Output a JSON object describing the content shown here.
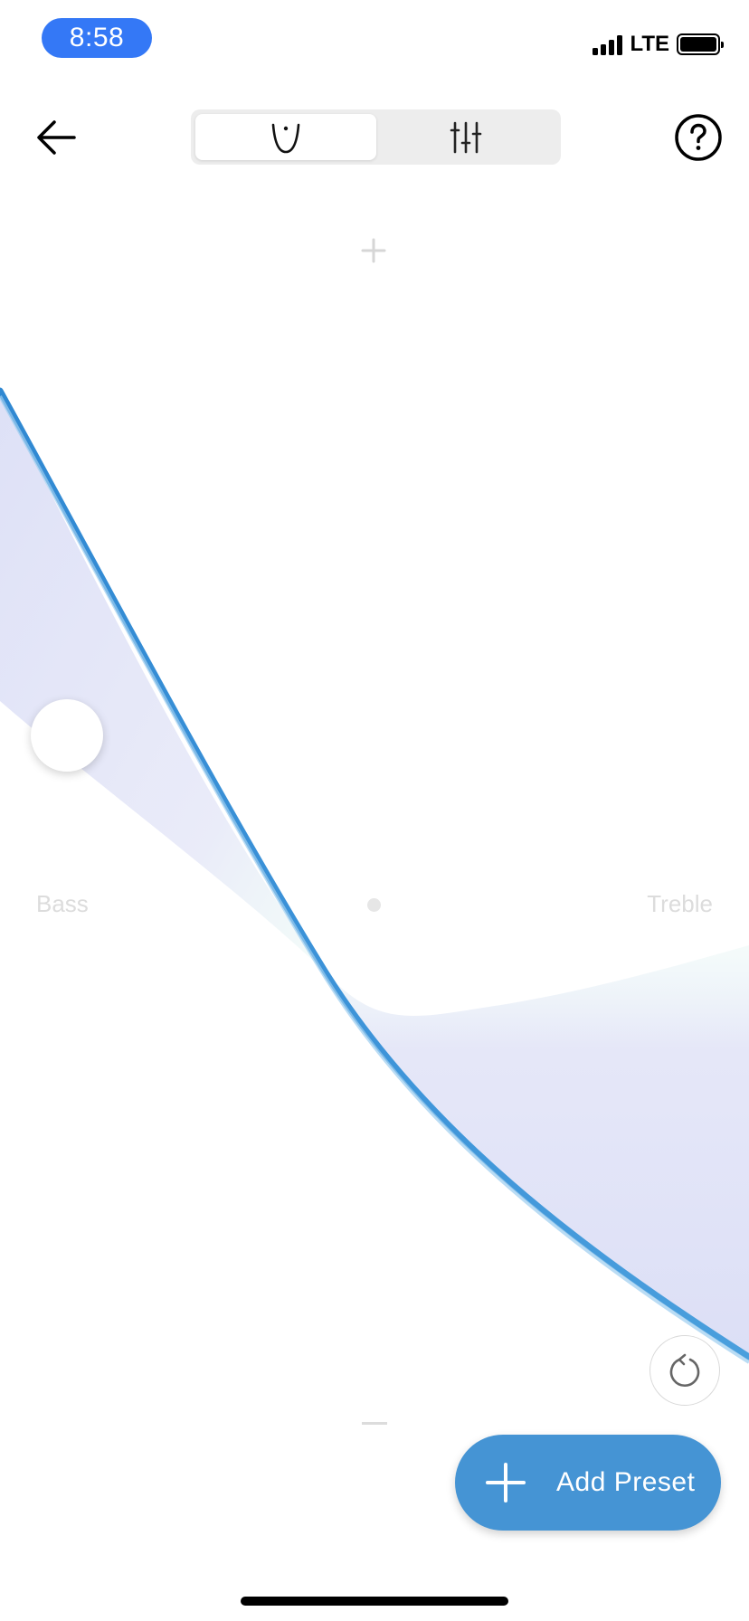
{
  "status_bar": {
    "time": "8:58",
    "network": "LTE"
  },
  "nav": {
    "back_icon": "arrow-left-icon",
    "help_icon": "question-circle-icon",
    "tabs": [
      {
        "icon": "curve-mode-icon",
        "active": true
      },
      {
        "icon": "sliders-mode-icon",
        "active": false
      }
    ]
  },
  "eq": {
    "bass_label": "Bass",
    "treble_label": "Treble",
    "increase_icon": "plus-icon",
    "decrease_icon": "minus-icon"
  },
  "actions": {
    "reset_icon": "reset-icon",
    "add_preset_label": "Add Preset",
    "add_icon": "plus-icon"
  },
  "colors": {
    "time_pill": "#3478f6",
    "accent": "#4594d4",
    "curve_edge": "#3a8fd4",
    "band_fill": "#e0e2f7"
  }
}
